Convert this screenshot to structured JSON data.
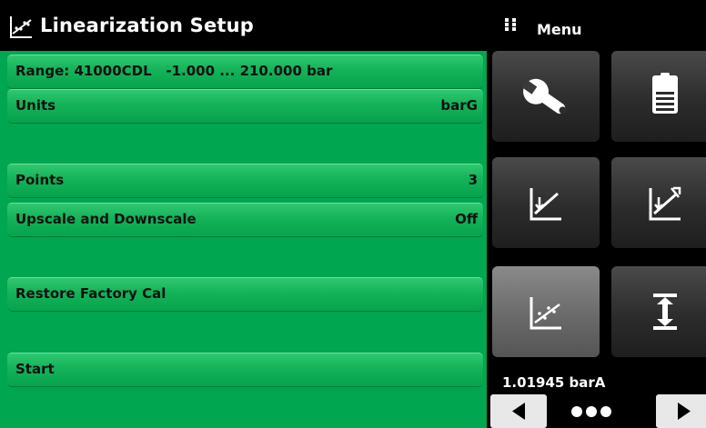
{
  "header": {
    "title": "Linearization Setup",
    "title_icon": "linearization-chart-icon"
  },
  "menu_header": {
    "label": "Menu",
    "icon": "grid-dots-icon"
  },
  "settings": {
    "range": {
      "label": "Range: 41000CDL   -1.000 ... 210.000 bar"
    },
    "units": {
      "label": "Units",
      "value": "barG"
    },
    "points": {
      "label": "Points",
      "value": "3"
    },
    "upscale_downscale": {
      "label": "Upscale and Downscale",
      "value": "Off"
    },
    "restore": {
      "label": "Restore Factory Cal"
    },
    "start": {
      "label": "Start"
    }
  },
  "menu": {
    "tiles": [
      {
        "icon": "wrench-icon",
        "active": false
      },
      {
        "icon": "document-icon",
        "active": false
      },
      {
        "icon": "zero-calibration-icon",
        "active": false
      },
      {
        "icon": "span-calibration-icon",
        "active": false
      },
      {
        "icon": "linearization-icon",
        "active": true
      },
      {
        "icon": "head-correction-icon",
        "active": false
      }
    ],
    "barometer": "1.01945 barA",
    "pager": {
      "pages": 3
    }
  },
  "colors": {
    "panel_bg": "#00a650",
    "row_text": "#101010",
    "menu_bg": "#000000",
    "tile_active": "#6a6a6a"
  }
}
